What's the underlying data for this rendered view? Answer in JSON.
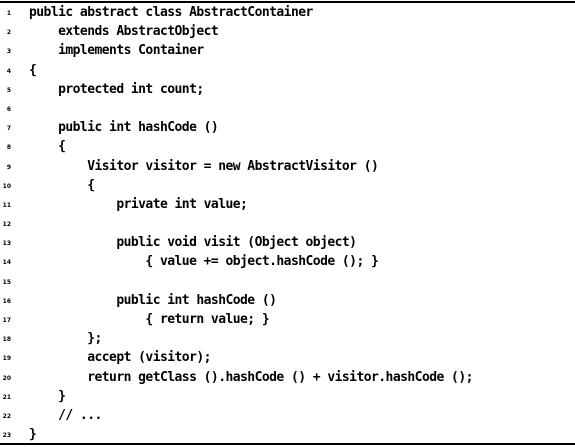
{
  "listing": {
    "lines": [
      {
        "number": "1",
        "code": "public abstract class AbstractContainer"
      },
      {
        "number": "2",
        "code": "    extends AbstractObject"
      },
      {
        "number": "3",
        "code": "    implements Container"
      },
      {
        "number": "4",
        "code": "{"
      },
      {
        "number": "5",
        "code": "    protected int count;"
      },
      {
        "number": "6",
        "code": ""
      },
      {
        "number": "7",
        "code": "    public int hashCode ()"
      },
      {
        "number": "8",
        "code": "    {"
      },
      {
        "number": "9",
        "code": "        Visitor visitor = new AbstractVisitor ()"
      },
      {
        "number": "10",
        "code": "        {"
      },
      {
        "number": "11",
        "code": "            private int value;"
      },
      {
        "number": "12",
        "code": ""
      },
      {
        "number": "13",
        "code": "            public void visit (Object object)"
      },
      {
        "number": "14",
        "code": "                { value += object.hashCode (); }"
      },
      {
        "number": "15",
        "code": ""
      },
      {
        "number": "16",
        "code": "            public int hashCode ()"
      },
      {
        "number": "17",
        "code": "                { return value; }"
      },
      {
        "number": "18",
        "code": "        };"
      },
      {
        "number": "19",
        "code": "        accept (visitor);"
      },
      {
        "number": "20",
        "code": "        return getClass ().hashCode () + visitor.hashCode ();"
      },
      {
        "number": "21",
        "code": "    }"
      },
      {
        "number": "22",
        "code": "    // ..."
      },
      {
        "number": "23",
        "code": "}"
      }
    ]
  }
}
